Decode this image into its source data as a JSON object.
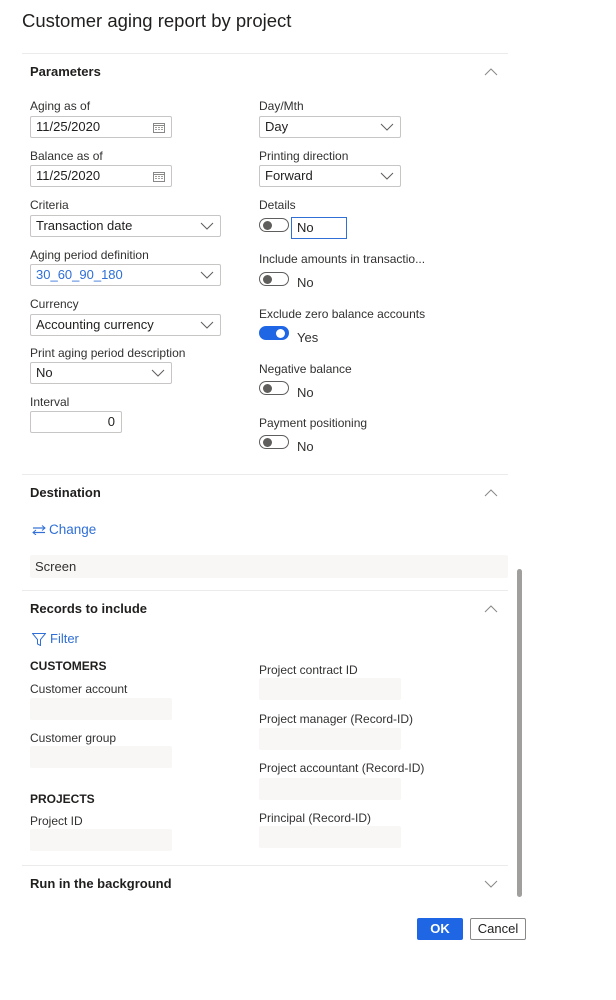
{
  "dialog": {
    "title": "Customer aging report by project"
  },
  "parameters": {
    "title": "Parameters",
    "left": {
      "aging_as_of": {
        "label": "Aging as of",
        "value": "11/25/2020"
      },
      "balance_as_of": {
        "label": "Balance as of",
        "value": "11/25/2020"
      },
      "criteria": {
        "label": "Criteria",
        "value": "Transaction date"
      },
      "aging_period_definition": {
        "label": "Aging period definition",
        "value": "30_60_90_180"
      },
      "currency": {
        "label": "Currency",
        "value": "Accounting currency"
      },
      "print_aging_period_description": {
        "label": "Print aging period description",
        "value": "No"
      },
      "interval": {
        "label": "Interval",
        "value": "0"
      }
    },
    "right": {
      "day_mth": {
        "label": "Day/Mth",
        "value": "Day"
      },
      "printing_direction": {
        "label": "Printing direction",
        "value": "Forward"
      },
      "details": {
        "label": "Details",
        "value": "No",
        "on": false
      },
      "include_amounts": {
        "label": "Include amounts in transactio...",
        "value": "No",
        "on": false
      },
      "exclude_zero_balance": {
        "label": "Exclude zero balance accounts",
        "value": "Yes",
        "on": true
      },
      "negative_balance": {
        "label": "Negative balance",
        "value": "No",
        "on": false
      },
      "payment_positioning": {
        "label": "Payment positioning",
        "value": "No",
        "on": false
      }
    }
  },
  "destination": {
    "title": "Destination",
    "change_label": "Change",
    "value": "Screen"
  },
  "records": {
    "title": "Records to include",
    "filter_label": "Filter",
    "customers_heading": "CUSTOMERS",
    "customer_account": {
      "label": "Customer account",
      "value": ""
    },
    "customer_group": {
      "label": "Customer group",
      "value": ""
    },
    "projects_heading": "PROJECTS",
    "project_id": {
      "label": "Project ID",
      "value": ""
    },
    "project_contract_id": {
      "label": "Project contract ID",
      "value": ""
    },
    "project_manager": {
      "label": "Project manager (Record-ID)",
      "value": ""
    },
    "project_accountant": {
      "label": "Project accountant (Record-ID)",
      "value": ""
    },
    "principal": {
      "label": "Principal (Record-ID)",
      "value": ""
    }
  },
  "background": {
    "title": "Run in the background"
  },
  "actions": {
    "ok_label": "OK",
    "cancel_label": "Cancel"
  },
  "colors": {
    "accent": "#1f66e5",
    "link": "#2f6fd6"
  }
}
